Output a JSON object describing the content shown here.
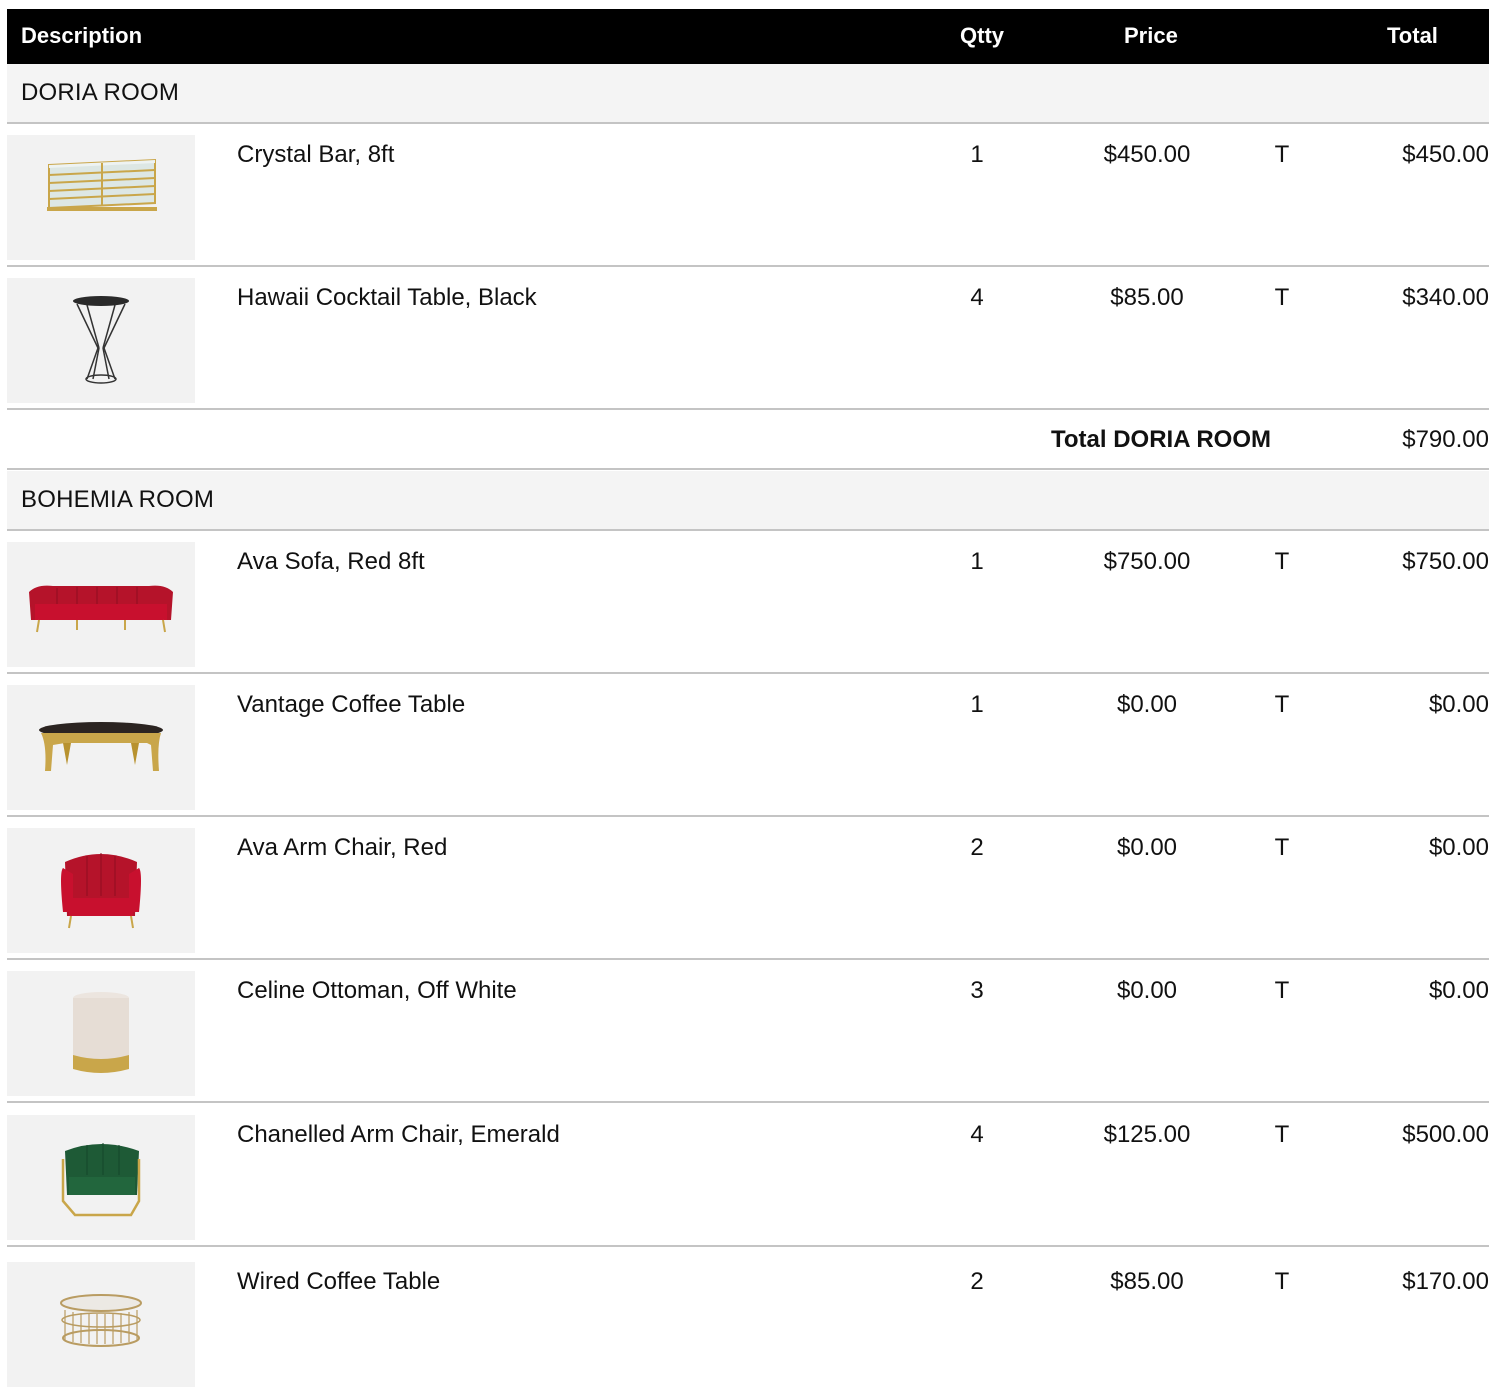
{
  "header": {
    "description": "Description",
    "qty": "Qtty",
    "price": "Price",
    "total": "Total"
  },
  "sections": [
    {
      "name": "DORIA ROOM",
      "items": [
        {
          "description": "Crystal Bar, 8ft",
          "qty": "1",
          "price": "$450.00",
          "tax": "T",
          "total": "$450.00",
          "image_icon": "crystal-bar-icon"
        },
        {
          "description": "Hawaii Cocktail Table, Black",
          "qty": "4",
          "price": "$85.00",
          "tax": "T",
          "total": "$340.00",
          "image_icon": "cocktail-table-icon"
        }
      ],
      "total_label": "Total DORIA ROOM",
      "total_value": "$790.00"
    },
    {
      "name": "BOHEMIA ROOM",
      "items": [
        {
          "description": "Ava Sofa, Red 8ft",
          "qty": "1",
          "price": "$750.00",
          "tax": "T",
          "total": "$750.00",
          "image_icon": "sofa-icon"
        },
        {
          "description": "Vantage Coffee Table",
          "qty": "1",
          "price": "$0.00",
          "tax": "T",
          "total": "$0.00",
          "image_icon": "coffee-table-icon"
        },
        {
          "description": "Ava Arm Chair, Red",
          "qty": "2",
          "price": "$0.00",
          "tax": "T",
          "total": "$0.00",
          "image_icon": "red-armchair-icon"
        },
        {
          "description": "Celine Ottoman, Off White",
          "qty": "3",
          "price": "$0.00",
          "tax": "T",
          "total": "$0.00",
          "image_icon": "ottoman-icon"
        },
        {
          "description": "Chanelled Arm Chair, Emerald",
          "qty": "4",
          "price": "$125.00",
          "tax": "T",
          "total": "$500.00",
          "image_icon": "emerald-armchair-icon"
        },
        {
          "description": "Wired Coffee Table",
          "qty": "2",
          "price": "$85.00",
          "tax": "T",
          "total": "$170.00",
          "image_icon": "wired-table-icon"
        }
      ]
    }
  ],
  "colors": {
    "header_bg": "#000000",
    "band_bg": "#f4f4f4",
    "divider": "#c4c4c4",
    "thumb_bg": "#f2f2f2"
  }
}
